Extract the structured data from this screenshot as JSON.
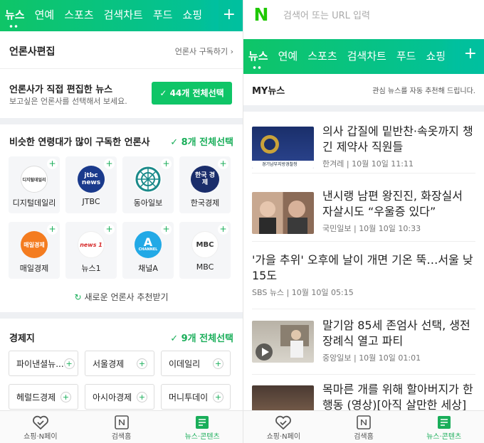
{
  "left": {
    "tabs": [
      "뉴스",
      "연예",
      "스포츠",
      "검색차트",
      "푸드",
      "쇼핑"
    ],
    "editor_section": {
      "title": "언론사편집",
      "subscribe_link": "언론사 구독하기",
      "headline": "언론사가 직접 편집한 뉴스",
      "subtext": "보고싶은 언론사를 선택해서 보세요.",
      "select_all": "44개 전체선택"
    },
    "similar_section": {
      "title": "비슷한 연령대가 많이 구독한 언론사",
      "select_all": "8개 전체선택",
      "publishers": [
        {
          "name": "디지털데일리",
          "logo": "디지털데일리",
          "color": "#fff"
        },
        {
          "name": "JTBC",
          "logo": "jtbc news",
          "color": "#1a3a8c"
        },
        {
          "name": "동아일보",
          "logo": "",
          "color": "#1b8a8a"
        },
        {
          "name": "한국경제",
          "logo": "한국 경제",
          "color": "#1a2d6b"
        },
        {
          "name": "매일경제",
          "logo": "매일경제",
          "color": "#f47c20"
        },
        {
          "name": "뉴스1",
          "logo": "news 1",
          "color": "#fff"
        },
        {
          "name": "채널A",
          "logo": "CHANNEL",
          "color": "#22a9e6"
        },
        {
          "name": "MBC",
          "logo": "MBC",
          "color": "#fff"
        }
      ],
      "refresh": "새로운 언론사 추천받기"
    },
    "economy_section": {
      "title": "경제지",
      "select_all": "9개 전체선택",
      "chips": [
        "파이낸셜뉴...",
        "서울경제",
        "이데일리",
        "헤럴드경제",
        "아시아경제",
        "머니투데이"
      ]
    }
  },
  "right": {
    "search_placeholder": "검색어 또는 URL 입력",
    "tabs": [
      "뉴스",
      "연예",
      "스포츠",
      "검색차트",
      "푸드",
      "쇼핑"
    ],
    "my_news": {
      "title": "MY뉴스",
      "subtitle": "관심 뉴스를 자동 추천해 드립니다."
    },
    "articles": [
      {
        "title": "의사 갑질에 밑반찬·속옷까지 챙긴 제약사 직원들",
        "source": "한겨레",
        "time": "10월 10일 11:11",
        "thumb": "police",
        "thumb_caption": "경기남부지방경찰청"
      },
      {
        "title": "낸시랭 남편 왕진진, 화장실서 자살시도 “우울증 있다”",
        "source": "국민일보",
        "time": "10월 10일 10:33",
        "thumb": "people"
      },
      {
        "title": "'가을 추위' 오후에 날이 개면 기온 뚝…서울 낮 15도",
        "source": "SBS 뉴스",
        "time": "10월 10일 05:15",
        "thumb": ""
      },
      {
        "title": "말기암 85세 존엄사 선택, 생전 장례식 열고 파티",
        "source": "중앙일보",
        "time": "10월 10일 01:01",
        "thumb": "video"
      },
      {
        "title": "목마른 개를 위해 할아버지가 한 행동 (영상)[아직 살만한 세상]",
        "source": "",
        "time": "",
        "thumb": "dog"
      }
    ]
  },
  "bottom_nav": [
    "쇼핑·N페이",
    "검색홈",
    "뉴스·콘텐츠"
  ],
  "colors": {
    "accent": "#0fc567",
    "naver_green": "#1ec800"
  }
}
